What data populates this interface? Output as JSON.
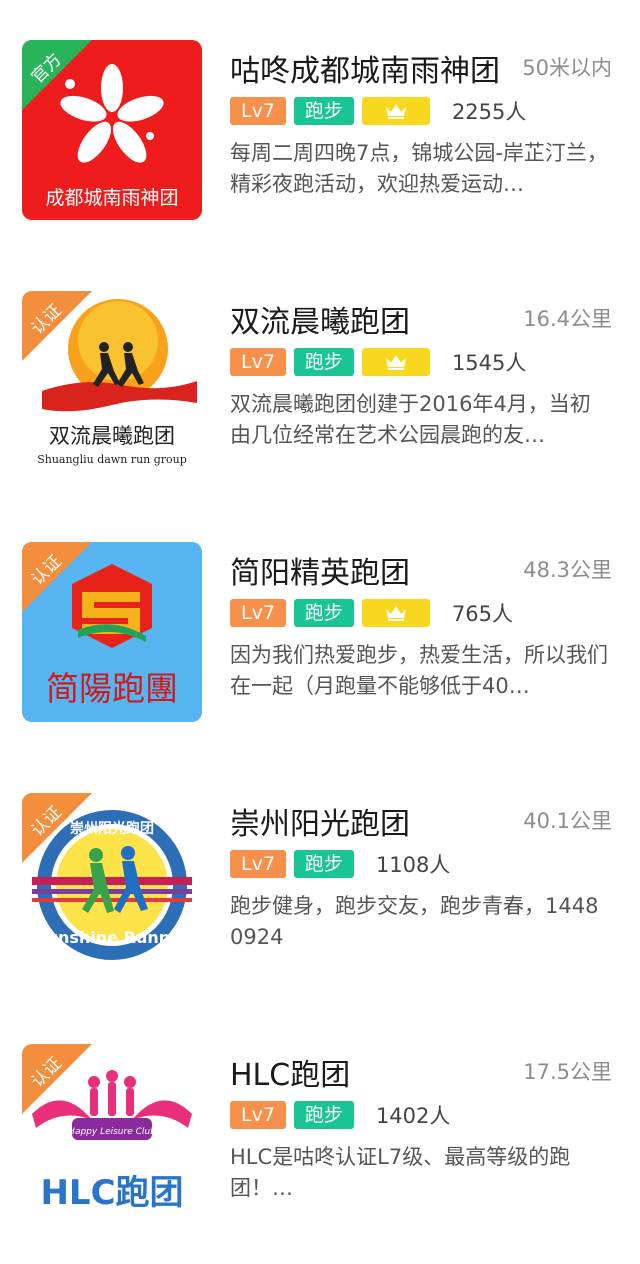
{
  "colors": {
    "lv_badge": "#f7904a",
    "sport_badge": "#19c693",
    "crown_badge": "#f8d81f",
    "official_ribbon": "#29b35a",
    "certified_ribbon": "#f58e3c"
  },
  "groups": [
    {
      "name": "咕咚成都城南雨神团",
      "distance": "50米以内",
      "level": "Lv7",
      "sport": "跑步",
      "has_crown": true,
      "members": "2255人",
      "description": "每周二周四晚7点，锦城公园-岸芷汀兰，精彩夜跑活动，欢迎热爱运动…",
      "ribbon": "官方",
      "logo_text": "成都城南雨神团"
    },
    {
      "name": "双流晨曦跑团",
      "distance": "16.4公里",
      "level": "Lv7",
      "sport": "跑步",
      "has_crown": true,
      "members": "1545人",
      "description": "双流晨曦跑团创建于2016年4月，当初由几位经常在艺术公园晨跑的友…",
      "ribbon": "认证",
      "logo_text": "双流晨曦跑团",
      "logo_subtext": "Shuangliu dawn run group"
    },
    {
      "name": "简阳精英跑团",
      "distance": "48.3公里",
      "level": "Lv7",
      "sport": "跑步",
      "has_crown": true,
      "members": "765人",
      "description": "因为我们热爱跑步，热爱生活，所以我们在一起（月跑量不能够低于40…",
      "ribbon": "认证",
      "logo_text": "简陽跑團"
    },
    {
      "name": "崇州阳光跑团",
      "distance": "40.1公里",
      "level": "Lv7",
      "sport": "跑步",
      "has_crown": false,
      "members": "1108人",
      "description": "跑步健身，跑步交友，跑步青春，14480924",
      "ribbon": "认证",
      "logo_text": "崇州阳光跑团",
      "logo_subtext": "Sunshine Runner"
    },
    {
      "name": "HLC跑团",
      "distance": "17.5公里",
      "level": "Lv7",
      "sport": "跑步",
      "has_crown": false,
      "members": "1402人",
      "description": "HLC是咕咚认证L7级、最高等级的跑团！…",
      "ribbon": "认证",
      "logo_text": "HLC跑团",
      "logo_subtext": "Happy Leisure Club"
    }
  ]
}
